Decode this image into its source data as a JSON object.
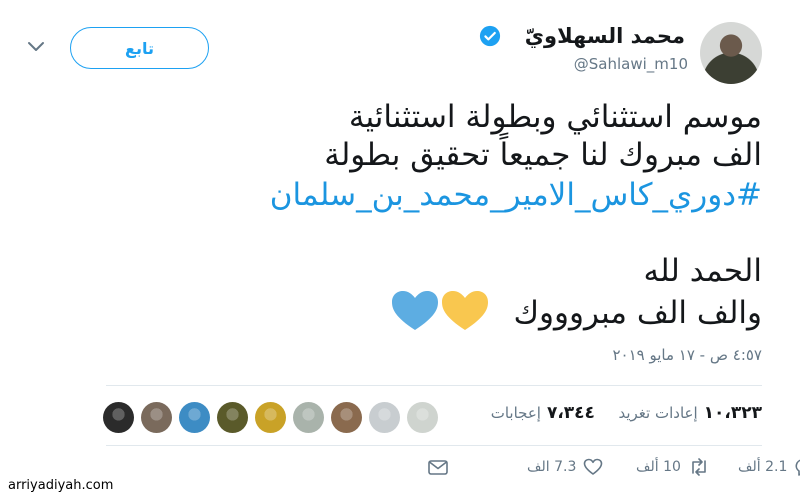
{
  "author": {
    "name": "محمد السهلاويّ",
    "handle": "@Sahlawi_m10",
    "verified": true
  },
  "follow_label": "تابع",
  "tweet": {
    "line1": "موسم استثنائي وبطولة استثنائية",
    "line2": "الف مبروك لنا جميعاً تحقيق بطولة",
    "hashtag": "#دوري_كاس_الامير_محمد_بن_سلمان",
    "line4": "الحمد لله",
    "line5": "والف الف مبروووك"
  },
  "timestamp": "٤:٥٧ ص - ١٧ مايو ٢٠١٩",
  "stats": {
    "retweets_count": "١٠،٣٢٣",
    "retweets_label": "إعادات تغريد",
    "likes_count": "٧،٣٤٤",
    "likes_label": "إعجابات"
  },
  "actions": {
    "replies": "2.1 ألف",
    "retweets": "10 ألف",
    "likes": "7.3 الف"
  },
  "watermark": "arriyadiyah.com",
  "colors": {
    "accent": "#1da1f2",
    "hashtag": "#1b95e0",
    "heart_yellow": "#f9c74f",
    "heart_blue": "#5dade2",
    "muted": "#657786"
  },
  "liker_avatars": [
    "#2b2b2b",
    "#7a6a5c",
    "#3d8cc4",
    "#5a5a2a",
    "#c9a227",
    "#a9b3ab",
    "#8a6a4e",
    "#c8cdd0",
    "#cfd4cf"
  ]
}
